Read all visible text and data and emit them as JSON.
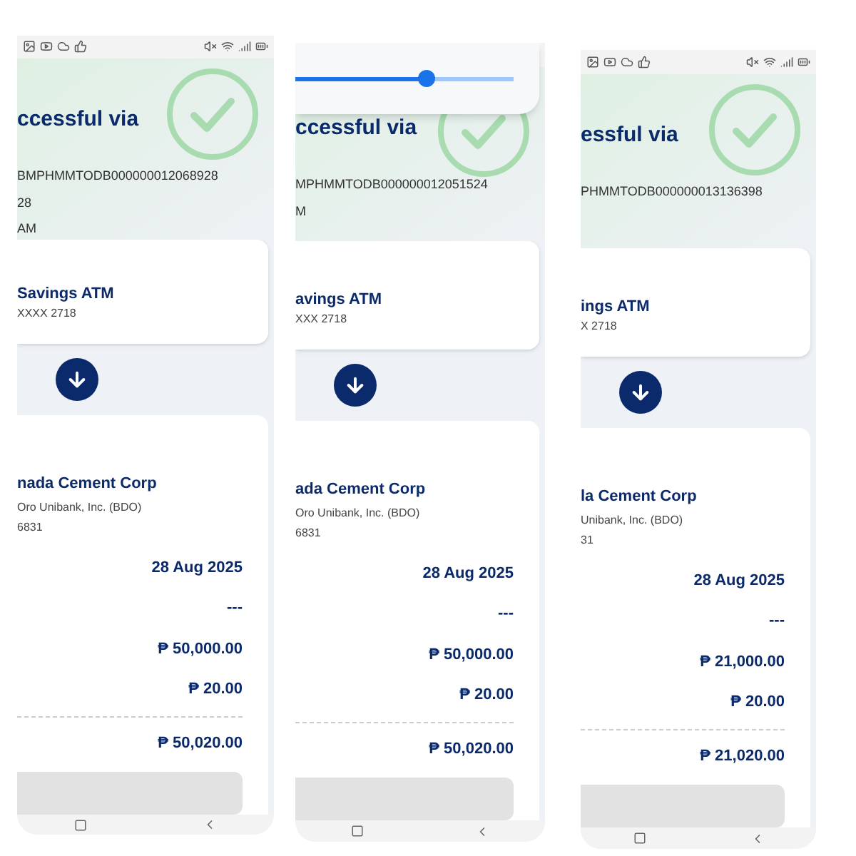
{
  "phones": [
    {
      "title": "ccessful via",
      "reference": "BMPHMMTODB000000012068928",
      "detail_lines": [
        "28",
        "AM"
      ],
      "source": {
        "name": "Savings ATM",
        "account": "XXXX 2718"
      },
      "destination": {
        "name": "nada Cement Corp",
        "bank": "Oro Unibank, Inc. (BDO)",
        "account": "6831"
      },
      "rows": [
        "28 Aug 2025",
        "---",
        "₱ 50,000.00",
        "₱ 20.00"
      ],
      "total": "₱ 50,020.00"
    },
    {
      "brightness_slider": {
        "level": 0.6
      },
      "title": "ccessful via",
      "reference": "MPHMMTODB000000012051524",
      "detail_lines": [
        "M"
      ],
      "source": {
        "name": "avings ATM",
        "account": "XXX 2718"
      },
      "destination": {
        "name": "ada Cement Corp",
        "bank": "Oro Unibank, Inc. (BDO)",
        "account": "6831"
      },
      "rows": [
        "28 Aug 2025",
        "---",
        "₱ 50,000.00",
        "₱ 20.00"
      ],
      "total": "₱ 50,020.00"
    },
    {
      "title": "essful via",
      "reference": "PHMMTODB000000013136398",
      "source": {
        "name": "ings ATM",
        "account": "X 2718"
      },
      "destination": {
        "name": "la Cement Corp",
        "bank": "Unibank, Inc. (BDO)",
        "account": "31"
      },
      "rows": [
        "28 Aug 2025",
        "---",
        "₱ 21,000.00",
        "₱ 20.00"
      ],
      "total": "₱ 21,020.00"
    }
  ]
}
